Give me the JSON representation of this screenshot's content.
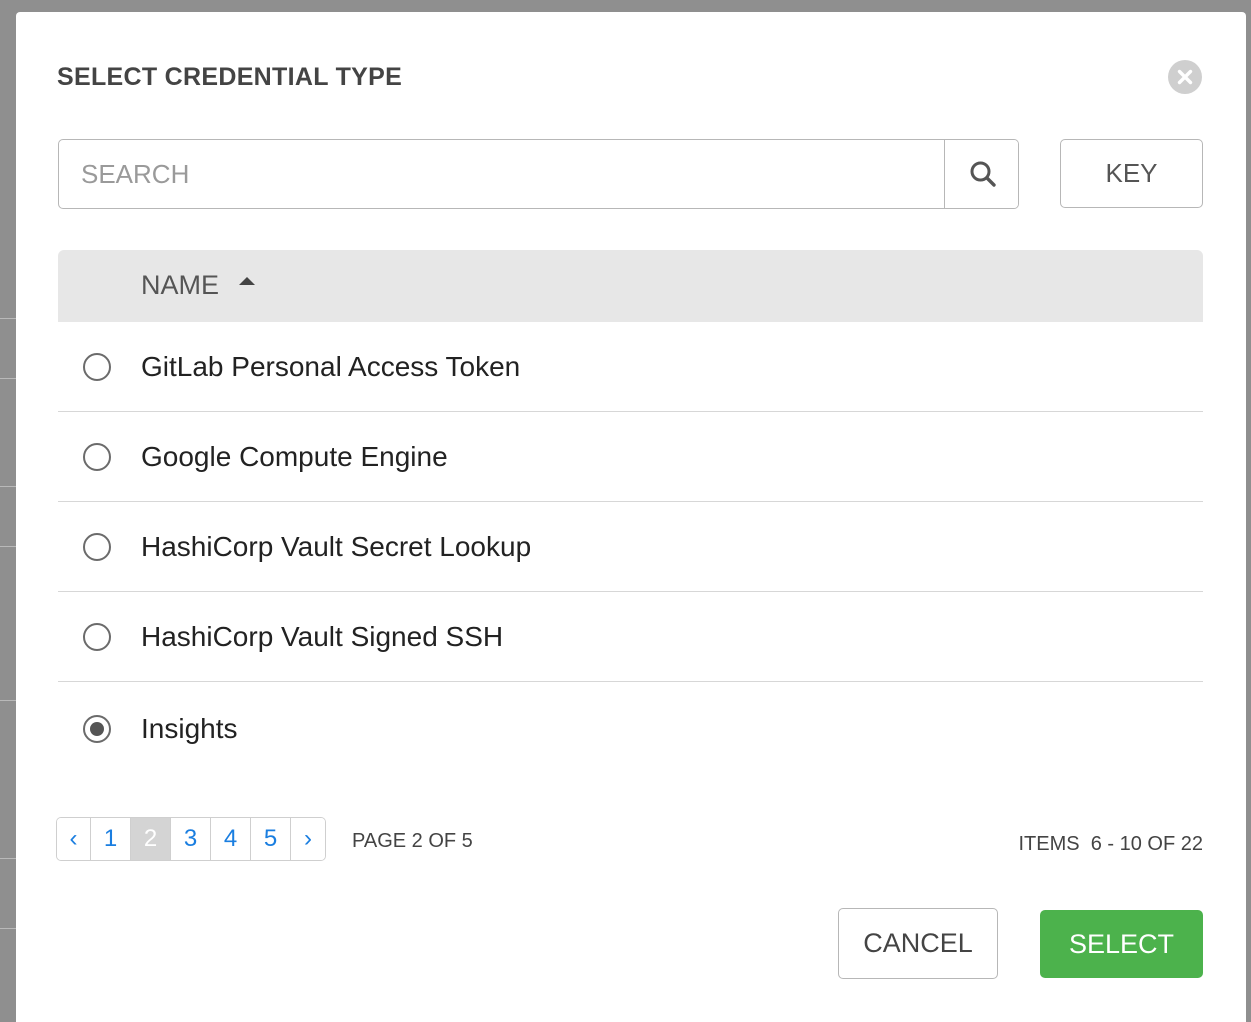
{
  "dialog": {
    "title": "SELECT CREDENTIAL TYPE",
    "close_icon": "close-circle-icon"
  },
  "search": {
    "placeholder": "SEARCH",
    "value": "",
    "button_icon": "search-icon",
    "key_label": "KEY"
  },
  "table": {
    "column_name": "NAME",
    "sort_direction": "ascending",
    "rows": [
      {
        "label": "GitLab Personal Access Token",
        "selected": false
      },
      {
        "label": "Google Compute Engine",
        "selected": false
      },
      {
        "label": "HashiCorp Vault Secret Lookup",
        "selected": false
      },
      {
        "label": "HashiCorp Vault Signed SSH",
        "selected": false
      },
      {
        "label": "Insights",
        "selected": true
      }
    ]
  },
  "pagination": {
    "prev": "‹",
    "next": "›",
    "pages": [
      "1",
      "2",
      "3",
      "4",
      "5"
    ],
    "current_page": "2",
    "page_info": "PAGE 2 OF 5",
    "items_info": "ITEMS  6 - 10 OF 22"
  },
  "footer": {
    "cancel_label": "CANCEL",
    "select_label": "SELECT"
  },
  "colors": {
    "select_button": "#4cb24c",
    "page_link": "#1a7ee0"
  }
}
